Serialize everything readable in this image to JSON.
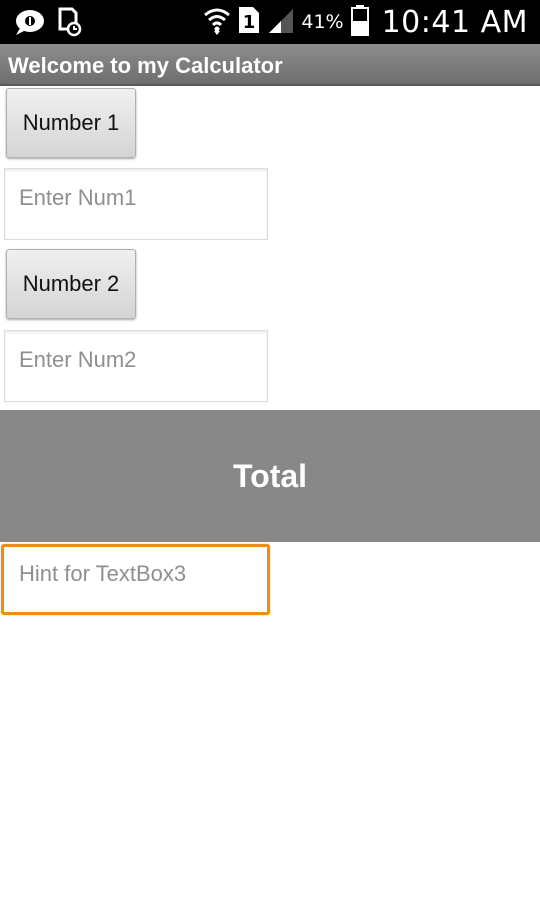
{
  "status_bar": {
    "battery_percent": "41%",
    "time": "10:41 AM",
    "icons": [
      "chat-bubble-icon",
      "sd-card-icon",
      "wifi-icon",
      "sim-1-icon",
      "signal-icon",
      "battery-icon"
    ]
  },
  "app": {
    "title": "Welcome to my Calculator"
  },
  "form": {
    "button1_label": "Number 1",
    "input1_placeholder": "Enter Num1",
    "button2_label": "Number 2",
    "input2_placeholder": "Enter Num2",
    "total_label": "Total",
    "input3_placeholder": "Hint for TextBox3"
  },
  "colors": {
    "title_bar": "#7d7d7d",
    "total_bar": "#888888",
    "focus_border": "#f28b17"
  }
}
